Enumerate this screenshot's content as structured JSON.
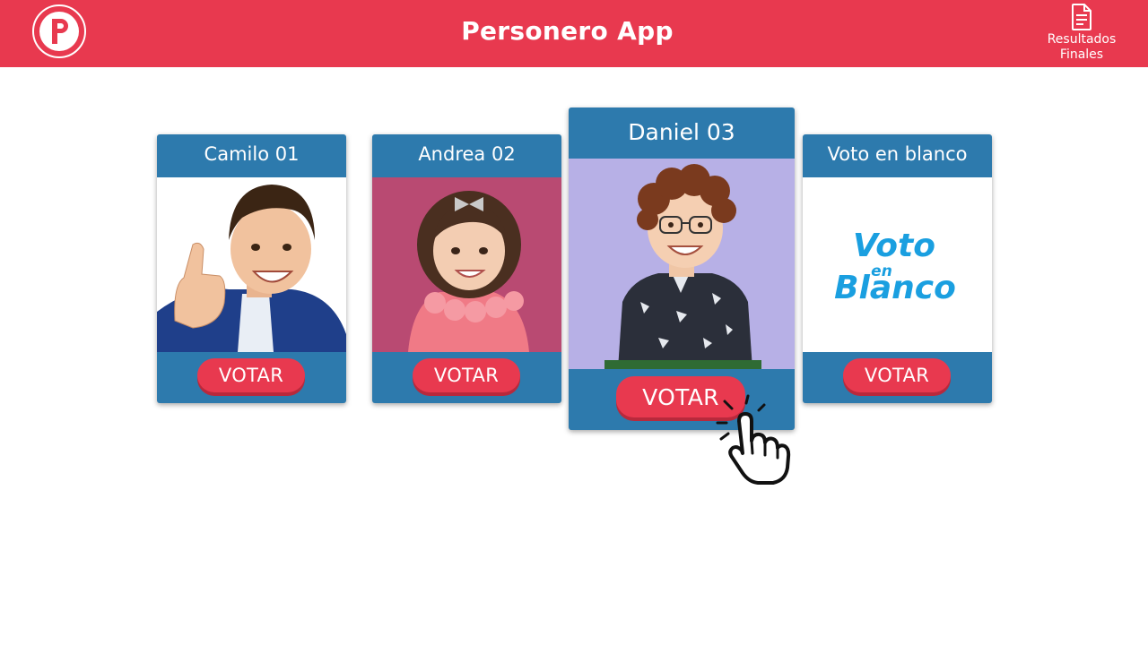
{
  "header": {
    "logo_letter": "P",
    "title": "Personero App",
    "results_label_line1": "Resultados",
    "results_label_line2": "Finales",
    "results_icon": "document-icon",
    "accent_color": "#e8394f"
  },
  "candidates": [
    {
      "name": "Camilo 01",
      "vote_label": "VOTAR",
      "photo": "boy-thumbs-up-photo"
    },
    {
      "name": "Andrea 02",
      "vote_label": "VOTAR",
      "photo": "girl-pink-dress-photo"
    },
    {
      "name": "Daniel 03",
      "vote_label": "VOTAR",
      "photo": "boy-glasses-photo",
      "highlighted": true
    },
    {
      "name": "Voto en blanco",
      "vote_label": "VOTAR",
      "photo": "blank-vote-logo",
      "logo_lines": [
        "Voto",
        "en",
        "Blanco"
      ]
    }
  ],
  "card_color": "#2d7aad",
  "cursor_icon": "hand-pointer-icon"
}
